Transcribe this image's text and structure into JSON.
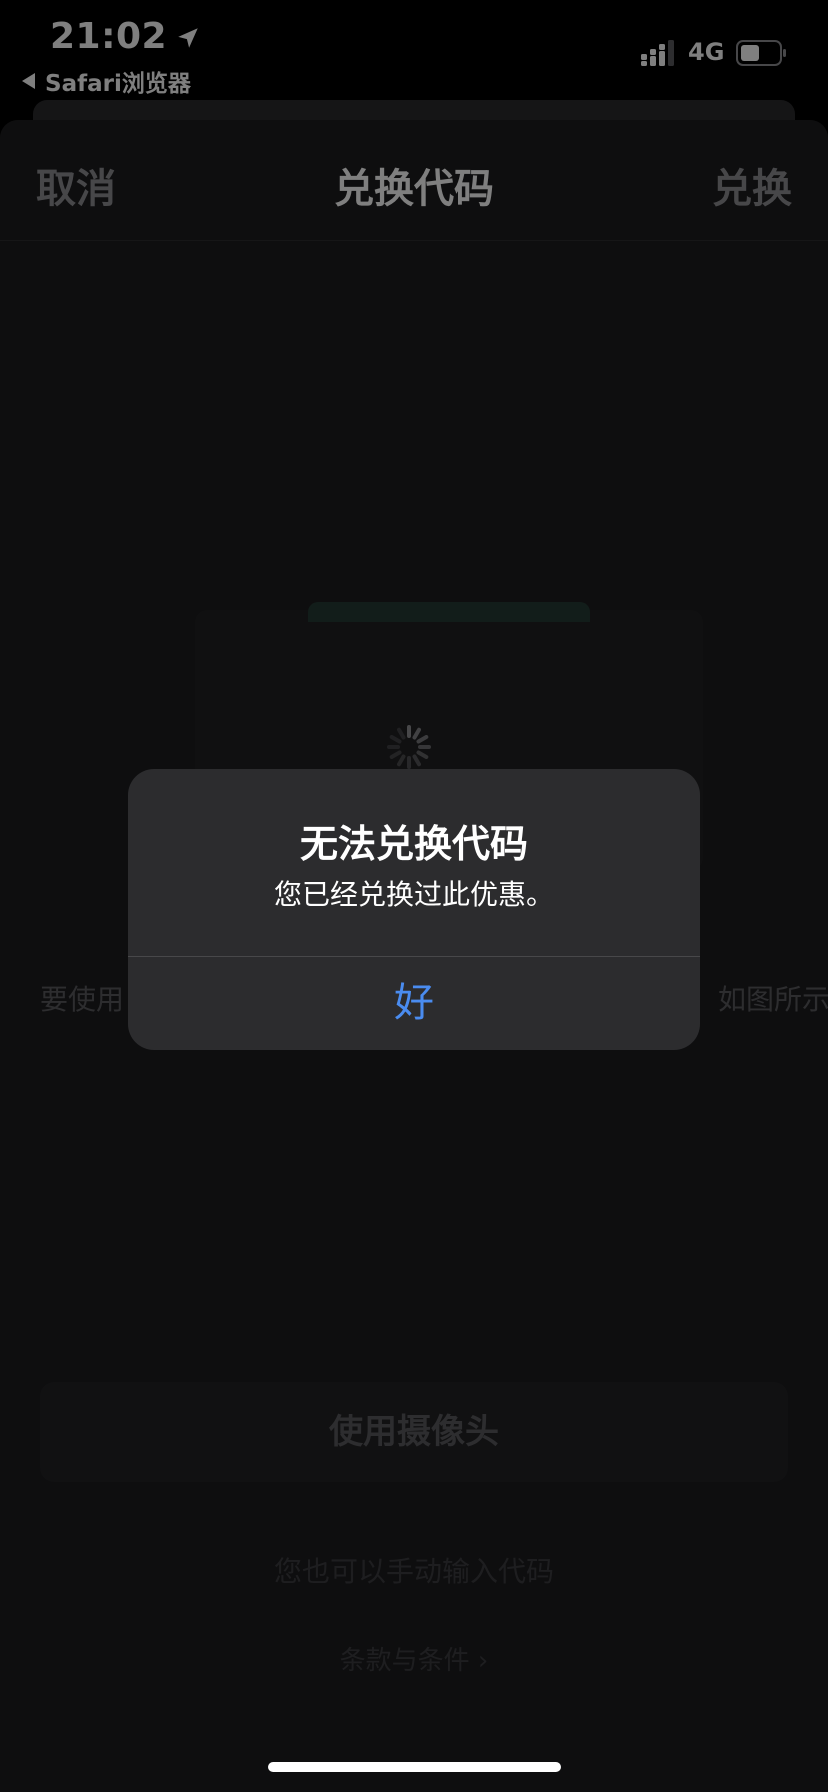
{
  "status_bar": {
    "time": "21:02",
    "back_app": "Safari浏览器",
    "network": "4G",
    "location_icon": "location-arrow-icon",
    "signal_icon": "cellular-signal-icon",
    "battery_icon": "battery-icon",
    "battery_level": 0.5
  },
  "nav": {
    "cancel_label": "取消",
    "title": "兑换代码",
    "redeem_label": "兑换"
  },
  "content": {
    "instructions_left": "要使用",
    "instructions_right": "如图所示",
    "camera_button_label": "使用摄像头",
    "manual_entry_label": "您也可以手动输入代码",
    "terms_label": "条款与条件 ›",
    "spinner_icon": "loading-spinner-icon"
  },
  "alert": {
    "title": "无法兑换代码",
    "message": "您已经兑换过此优惠。",
    "ok_label": "好"
  },
  "colors": {
    "background": "#000000",
    "sheet": "#1c1c1e",
    "alert_bg": "#2c2c2e",
    "accent_blue": "#4a8cf0"
  }
}
